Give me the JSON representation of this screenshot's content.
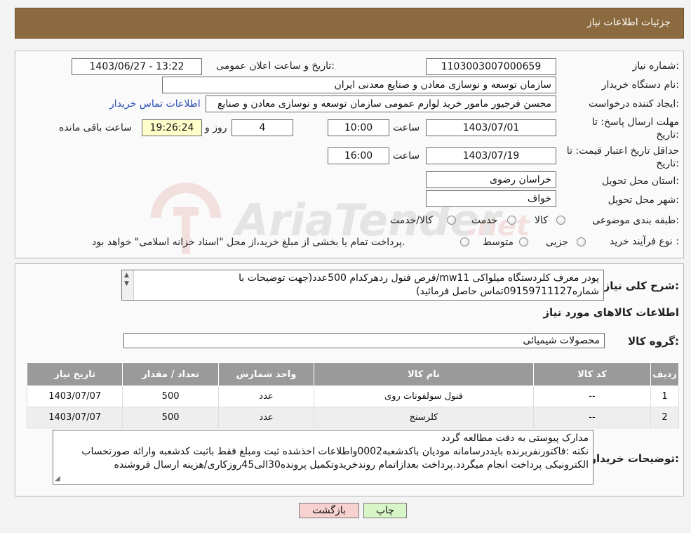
{
  "header": {
    "title": "جزئیات اطلاعات نیاز"
  },
  "fields": {
    "need_number_label": "شماره نیاز:",
    "need_number": "1103003007000659",
    "announce_label": "تاریخ و ساعت اعلان عمومی:",
    "announce_value": "1403/06/27 - 13:22",
    "buyer_org_label": "نام دستگاه خریدار:",
    "buyer_org": "سازمان توسعه و نوسازی معادن و صنایع معدنی ایران",
    "creator_label": "ایجاد کننده درخواست:",
    "creator": "محسن فرجیور مامور خرید لوازم عمومی سازمان توسعه و نوسازی معادن و صنایع",
    "contact_link": "اطلاعات تماس خریدار",
    "deadline_label_1": "مهلت ارسال پاسخ: تا",
    "deadline_label_2": "تاریخ:",
    "deadline_date": "1403/07/01",
    "hour_label": "ساعت",
    "deadline_time": "10:00",
    "days_value": "4",
    "days_label": "روز و",
    "remaining_time": "19:26:24",
    "remaining_label": "ساعت باقی مانده",
    "validity_label_1": "حداقل تاریخ اعتبار قیمت: تا",
    "validity_label_2": "تاریخ:",
    "validity_date": "1403/07/19",
    "validity_time": "16:00",
    "province_label": "استان محل تحویل:",
    "province": "خراسان رضوی",
    "city_label": "شهر محل تحویل:",
    "city": "خواف",
    "category_label": "طبقه بندی موضوعی:",
    "category_options": [
      "کالا",
      "خدمت",
      "کالا/خدمت"
    ],
    "process_label": "نوع فرآیند خرید :",
    "process_options": [
      "جزیی",
      "متوسط"
    ],
    "process_note": "پرداخت تمام یا بخشی از مبلغ خرید،از محل \"اسناد خزانه اسلامی\" خواهد بود."
  },
  "summary": {
    "label": "شرح کلی نیاز:",
    "line1": "پودر معرف کلردستگاه میلواکی mw11/قرص فنول ردهرکدام 500عدد(جهت توضیحات  با",
    "line2": "شماره09159711127تماس حاصل فرمائید)"
  },
  "goods": {
    "section_title": "اطلاعات کالاهای مورد نیاز",
    "group_label": "گروه کالا:",
    "group_value": "محصولات شیمیائی"
  },
  "table": {
    "headers": [
      "ردیف",
      "کد کالا",
      "نام کالا",
      "واحد شمارش",
      "تعداد / مقدار",
      "تاریخ نیاز"
    ],
    "rows": [
      [
        "1",
        "--",
        "فنول سولفونات روی",
        "عدد",
        "500",
        "1403/07/07"
      ],
      [
        "2",
        "--",
        "کلرسنج",
        "عدد",
        "500",
        "1403/07/07"
      ]
    ]
  },
  "buyer_notes": {
    "label": "توضیحات خریدار:",
    "line1": "مدارک پیوستی به دقت مطالعه گردد",
    "line2": "نکته :فاکتورنفربرنده بایددرسامانه مودیان باکدشعبه0002واطلاعات اخذشده ثبت ومبلغ فقط باثبت کدشعبه وارائه صورتحساب",
    "line3": "الکترونیکی پرداخت انجام میگردد.پرداخت بعدازاتمام روندخریدوتکمیل پرونده30الی45روزکاری/هزینه ارسال فروشنده"
  },
  "buttons": {
    "print": "چاپ",
    "back": "بازگشت"
  },
  "watermark": "AriaTender.net",
  "colors": {
    "header_bg": "#8c6a3f",
    "link": "#2a4fb5",
    "back_btn": "#f7d0d0",
    "print_btn": "#d8f5c8"
  }
}
